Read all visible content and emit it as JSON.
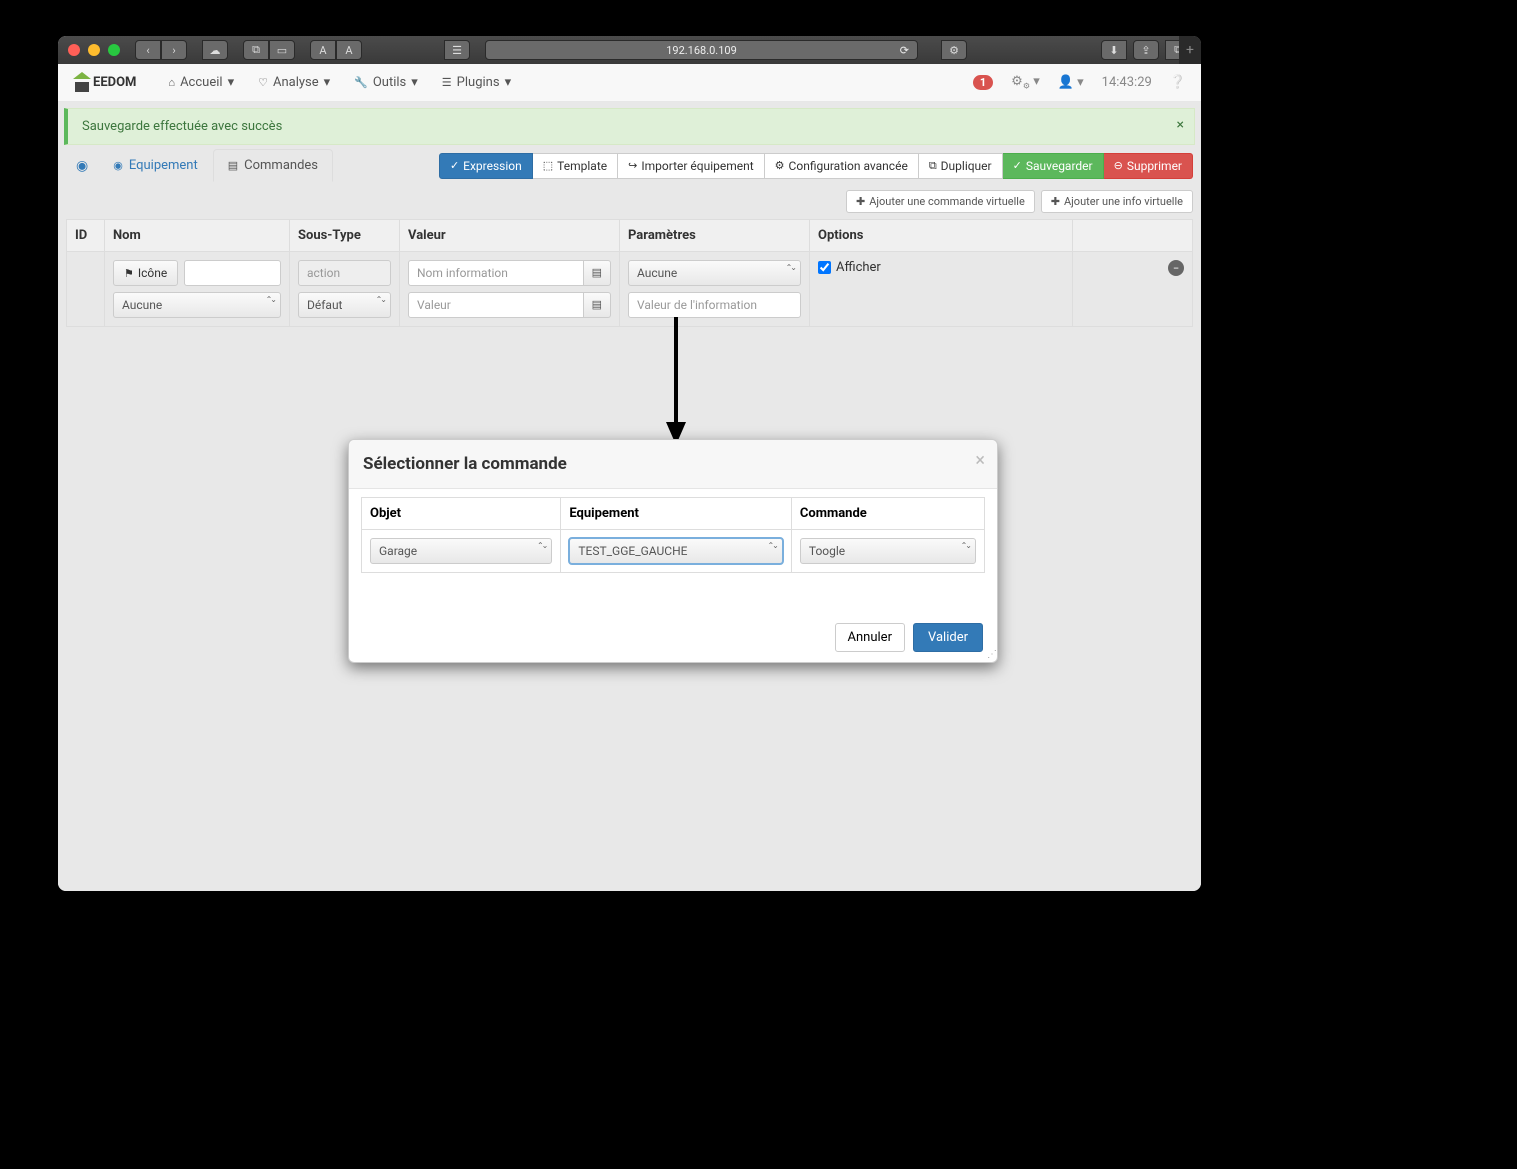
{
  "browser": {
    "url": "192.168.0.109"
  },
  "logo_text": "EEDOM",
  "nav": {
    "accueil": "Accueil",
    "analyse": "Analyse",
    "outils": "Outils",
    "plugins": "Plugins"
  },
  "nav_right": {
    "badge": "1",
    "time": "14:43:29"
  },
  "alert": "Sauvegarde effectuée avec succès",
  "tabs": {
    "equipement": "Equipement",
    "commandes": "Commandes"
  },
  "actions": {
    "expression": "Expression",
    "template": "Template",
    "importer": "Importer équipement",
    "config": "Configuration avancée",
    "dupliquer": "Dupliquer",
    "sauvegarder": "Sauvegarder",
    "supprimer": "Supprimer"
  },
  "add": {
    "cmd": "Ajouter une commande virtuelle",
    "info": "Ajouter une info virtuelle"
  },
  "table": {
    "headers": {
      "id": "ID",
      "nom": "Nom",
      "soustype": "Sous-Type",
      "valeur": "Valeur",
      "parametres": "Paramètres",
      "options": "Options"
    },
    "row": {
      "icone_btn": "Icône",
      "type_select": "Aucune",
      "soustype_action": "action",
      "soustype_defaut": "Défaut",
      "nom_placeholder": "Nom information",
      "valeur_placeholder": "Valeur",
      "param_select": "Aucune",
      "param_info_placeholder": "Valeur de l'information",
      "afficher": "Afficher"
    }
  },
  "modal": {
    "title": "Sélectionner la commande",
    "headers": {
      "objet": "Objet",
      "equipement": "Equipement",
      "commande": "Commande"
    },
    "values": {
      "objet": "Garage",
      "equipement": "TEST_GGE_GAUCHE",
      "commande": "Toogle"
    },
    "annuler": "Annuler",
    "valider": "Valider"
  }
}
